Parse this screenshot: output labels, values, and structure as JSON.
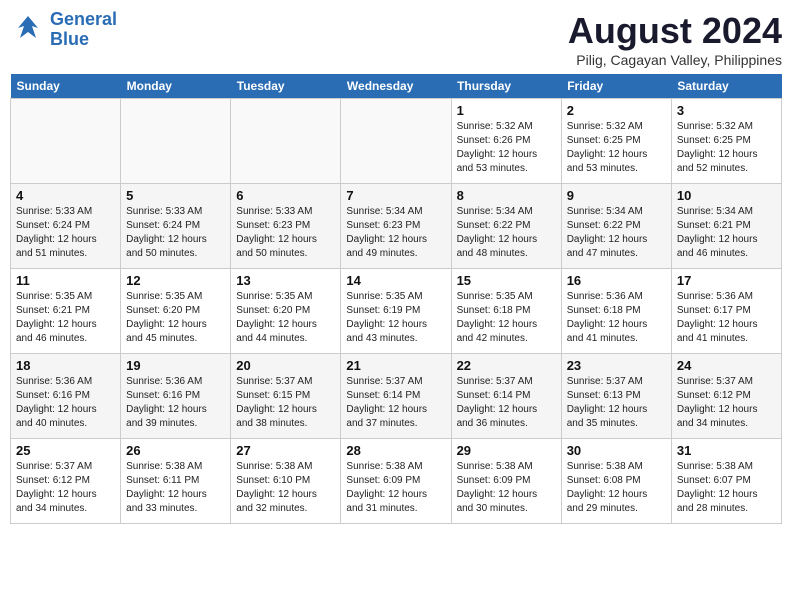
{
  "logo": {
    "line1": "General",
    "line2": "Blue"
  },
  "title": "August 2024",
  "location": "Pilig, Cagayan Valley, Philippines",
  "days_of_week": [
    "Sunday",
    "Monday",
    "Tuesday",
    "Wednesday",
    "Thursday",
    "Friday",
    "Saturday"
  ],
  "weeks": [
    [
      {
        "day": "",
        "info": ""
      },
      {
        "day": "",
        "info": ""
      },
      {
        "day": "",
        "info": ""
      },
      {
        "day": "",
        "info": ""
      },
      {
        "day": "1",
        "info": "Sunrise: 5:32 AM\nSunset: 6:26 PM\nDaylight: 12 hours\nand 53 minutes."
      },
      {
        "day": "2",
        "info": "Sunrise: 5:32 AM\nSunset: 6:25 PM\nDaylight: 12 hours\nand 53 minutes."
      },
      {
        "day": "3",
        "info": "Sunrise: 5:32 AM\nSunset: 6:25 PM\nDaylight: 12 hours\nand 52 minutes."
      }
    ],
    [
      {
        "day": "4",
        "info": "Sunrise: 5:33 AM\nSunset: 6:24 PM\nDaylight: 12 hours\nand 51 minutes."
      },
      {
        "day": "5",
        "info": "Sunrise: 5:33 AM\nSunset: 6:24 PM\nDaylight: 12 hours\nand 50 minutes."
      },
      {
        "day": "6",
        "info": "Sunrise: 5:33 AM\nSunset: 6:23 PM\nDaylight: 12 hours\nand 50 minutes."
      },
      {
        "day": "7",
        "info": "Sunrise: 5:34 AM\nSunset: 6:23 PM\nDaylight: 12 hours\nand 49 minutes."
      },
      {
        "day": "8",
        "info": "Sunrise: 5:34 AM\nSunset: 6:22 PM\nDaylight: 12 hours\nand 48 minutes."
      },
      {
        "day": "9",
        "info": "Sunrise: 5:34 AM\nSunset: 6:22 PM\nDaylight: 12 hours\nand 47 minutes."
      },
      {
        "day": "10",
        "info": "Sunrise: 5:34 AM\nSunset: 6:21 PM\nDaylight: 12 hours\nand 46 minutes."
      }
    ],
    [
      {
        "day": "11",
        "info": "Sunrise: 5:35 AM\nSunset: 6:21 PM\nDaylight: 12 hours\nand 46 minutes."
      },
      {
        "day": "12",
        "info": "Sunrise: 5:35 AM\nSunset: 6:20 PM\nDaylight: 12 hours\nand 45 minutes."
      },
      {
        "day": "13",
        "info": "Sunrise: 5:35 AM\nSunset: 6:20 PM\nDaylight: 12 hours\nand 44 minutes."
      },
      {
        "day": "14",
        "info": "Sunrise: 5:35 AM\nSunset: 6:19 PM\nDaylight: 12 hours\nand 43 minutes."
      },
      {
        "day": "15",
        "info": "Sunrise: 5:35 AM\nSunset: 6:18 PM\nDaylight: 12 hours\nand 42 minutes."
      },
      {
        "day": "16",
        "info": "Sunrise: 5:36 AM\nSunset: 6:18 PM\nDaylight: 12 hours\nand 41 minutes."
      },
      {
        "day": "17",
        "info": "Sunrise: 5:36 AM\nSunset: 6:17 PM\nDaylight: 12 hours\nand 41 minutes."
      }
    ],
    [
      {
        "day": "18",
        "info": "Sunrise: 5:36 AM\nSunset: 6:16 PM\nDaylight: 12 hours\nand 40 minutes."
      },
      {
        "day": "19",
        "info": "Sunrise: 5:36 AM\nSunset: 6:16 PM\nDaylight: 12 hours\nand 39 minutes."
      },
      {
        "day": "20",
        "info": "Sunrise: 5:37 AM\nSunset: 6:15 PM\nDaylight: 12 hours\nand 38 minutes."
      },
      {
        "day": "21",
        "info": "Sunrise: 5:37 AM\nSunset: 6:14 PM\nDaylight: 12 hours\nand 37 minutes."
      },
      {
        "day": "22",
        "info": "Sunrise: 5:37 AM\nSunset: 6:14 PM\nDaylight: 12 hours\nand 36 minutes."
      },
      {
        "day": "23",
        "info": "Sunrise: 5:37 AM\nSunset: 6:13 PM\nDaylight: 12 hours\nand 35 minutes."
      },
      {
        "day": "24",
        "info": "Sunrise: 5:37 AM\nSunset: 6:12 PM\nDaylight: 12 hours\nand 34 minutes."
      }
    ],
    [
      {
        "day": "25",
        "info": "Sunrise: 5:37 AM\nSunset: 6:12 PM\nDaylight: 12 hours\nand 34 minutes."
      },
      {
        "day": "26",
        "info": "Sunrise: 5:38 AM\nSunset: 6:11 PM\nDaylight: 12 hours\nand 33 minutes."
      },
      {
        "day": "27",
        "info": "Sunrise: 5:38 AM\nSunset: 6:10 PM\nDaylight: 12 hours\nand 32 minutes."
      },
      {
        "day": "28",
        "info": "Sunrise: 5:38 AM\nSunset: 6:09 PM\nDaylight: 12 hours\nand 31 minutes."
      },
      {
        "day": "29",
        "info": "Sunrise: 5:38 AM\nSunset: 6:09 PM\nDaylight: 12 hours\nand 30 minutes."
      },
      {
        "day": "30",
        "info": "Sunrise: 5:38 AM\nSunset: 6:08 PM\nDaylight: 12 hours\nand 29 minutes."
      },
      {
        "day": "31",
        "info": "Sunrise: 5:38 AM\nSunset: 6:07 PM\nDaylight: 12 hours\nand 28 minutes."
      }
    ]
  ]
}
